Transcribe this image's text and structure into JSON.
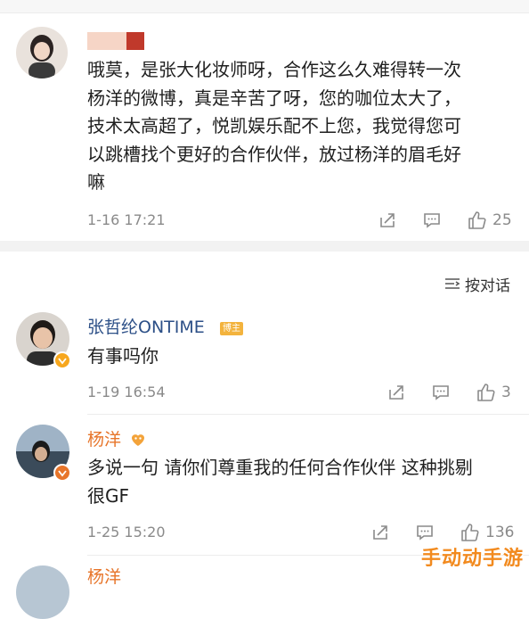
{
  "comments": [
    {
      "text": "哦莫，是张大化妆师呀，合作这么久难得转一次\n杨洋的微博，真是辛苦了呀，您的咖位太大了，\n技术太高超了，悦凯娱乐配不上您，我觉得您可\n以跳槽找个更好的合作伙伴，放过杨洋的眉毛好\n嘛",
      "time": "1-16 17:21",
      "likes": "25"
    }
  ],
  "thread": {
    "view_dialog": "按对话",
    "replies": [
      {
        "username": "张哲纶ONTIME",
        "tag": "博主",
        "text": "有事吗你",
        "time": "1-19 16:54",
        "likes": "3"
      },
      {
        "username": "杨洋",
        "text": "多说一句 请你们尊重我的任何合作伙伴 这种挑剔\n很GF",
        "time": "1-25 15:20",
        "likes": "136"
      },
      {
        "username": "杨洋"
      }
    ]
  },
  "watermark": "手动动手游",
  "colors": {
    "username_blue": "#2c4f87",
    "username_orange": "#e7752a",
    "verified_orange": "#f7a71d",
    "bg_separator": "#f2f2f2"
  },
  "icons": [
    "share-icon",
    "comment-icon",
    "thumbs-up-icon",
    "dialog-icon",
    "verified-icon",
    "heart-badge-icon"
  ]
}
